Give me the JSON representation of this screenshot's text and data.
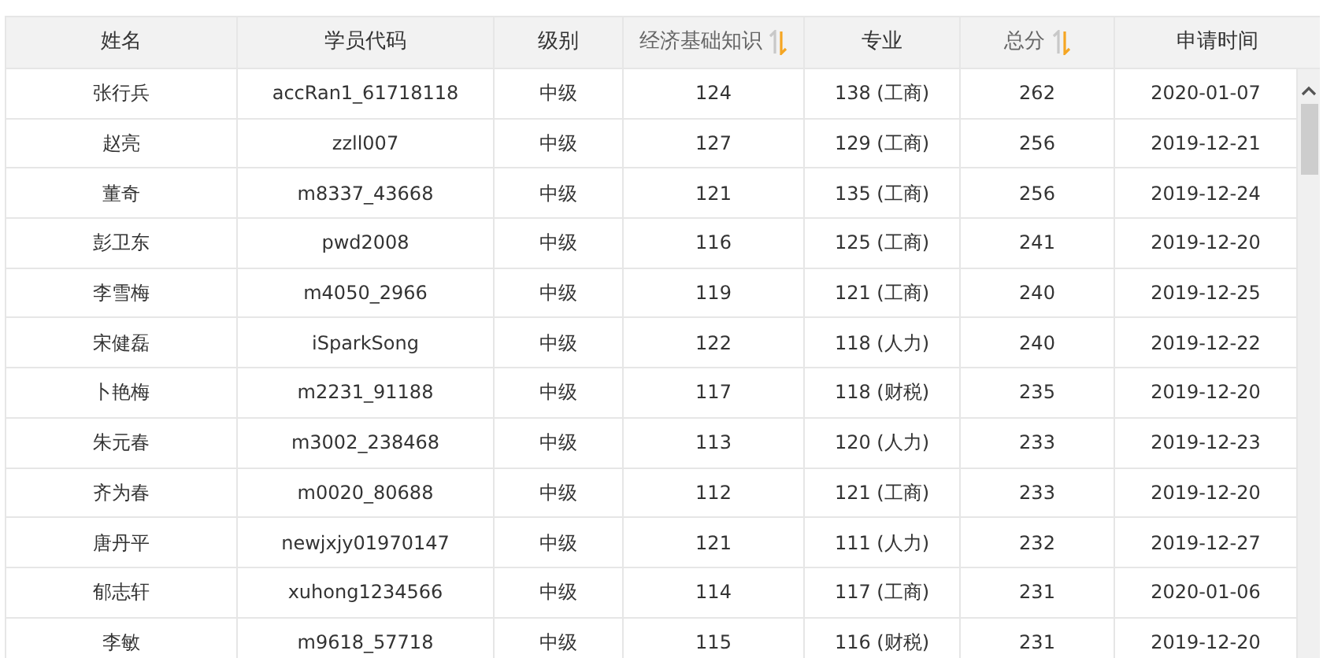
{
  "table": {
    "columns": [
      {
        "label": "姓名",
        "sortable": false
      },
      {
        "label": "学员代码",
        "sortable": false
      },
      {
        "label": "级别",
        "sortable": false
      },
      {
        "label": "经济基础知识",
        "sortable": true
      },
      {
        "label": "专业",
        "sortable": false
      },
      {
        "label": "总分",
        "sortable": true
      },
      {
        "label": "申请时间",
        "sortable": false
      }
    ],
    "rows": [
      [
        "张行兵",
        "accRan1_61718118",
        "中级",
        "124",
        "138 (工商)",
        "262",
        "2020-01-07"
      ],
      [
        "赵亮",
        "zzll007",
        "中级",
        "127",
        "129 (工商)",
        "256",
        "2019-12-21"
      ],
      [
        "董奇",
        "m8337_43668",
        "中级",
        "121",
        "135 (工商)",
        "256",
        "2019-12-24"
      ],
      [
        "彭卫东",
        "pwd2008",
        "中级",
        "116",
        "125 (工商)",
        "241",
        "2019-12-20"
      ],
      [
        "李雪梅",
        "m4050_2966",
        "中级",
        "119",
        "121 (工商)",
        "240",
        "2019-12-25"
      ],
      [
        "宋健磊",
        "iSparkSong",
        "中级",
        "122",
        "118 (人力)",
        "240",
        "2019-12-22"
      ],
      [
        "卜艳梅",
        "m2231_91188",
        "中级",
        "117",
        "118 (财税)",
        "235",
        "2019-12-20"
      ],
      [
        "朱元春",
        "m3002_238468",
        "中级",
        "113",
        "120 (人力)",
        "233",
        "2019-12-23"
      ],
      [
        "齐为春",
        "m0020_80688",
        "中级",
        "112",
        "121 (工商)",
        "233",
        "2019-12-20"
      ],
      [
        "唐丹平",
        "newjxjy01970147",
        "中级",
        "121",
        "111 (人力)",
        "232",
        "2019-12-27"
      ],
      [
        "郁志轩",
        "xuhong1234566",
        "中级",
        "114",
        "117 (工商)",
        "231",
        "2020-01-06"
      ],
      [
        "李敏",
        "m9618_57718",
        "中级",
        "115",
        "116 (财税)",
        "231",
        "2019-12-20"
      ]
    ]
  }
}
